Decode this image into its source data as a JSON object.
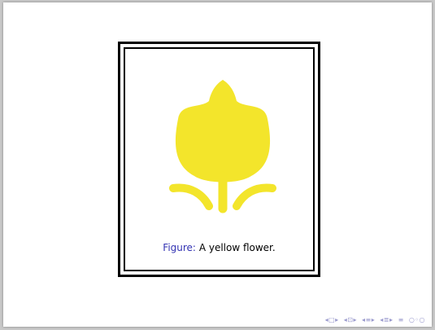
{
  "figure": {
    "label": "Figure:",
    "text": "A yellow flower.",
    "flower_color": "#f3e52b",
    "link_color": "#3333b3"
  },
  "nav": {
    "icons": [
      "nav-left-slide-icon",
      "nav-frame-icon",
      "nav-section-icon",
      "nav-subsection-icon",
      "nav-appendix-icon",
      "nav-search-icon"
    ]
  }
}
